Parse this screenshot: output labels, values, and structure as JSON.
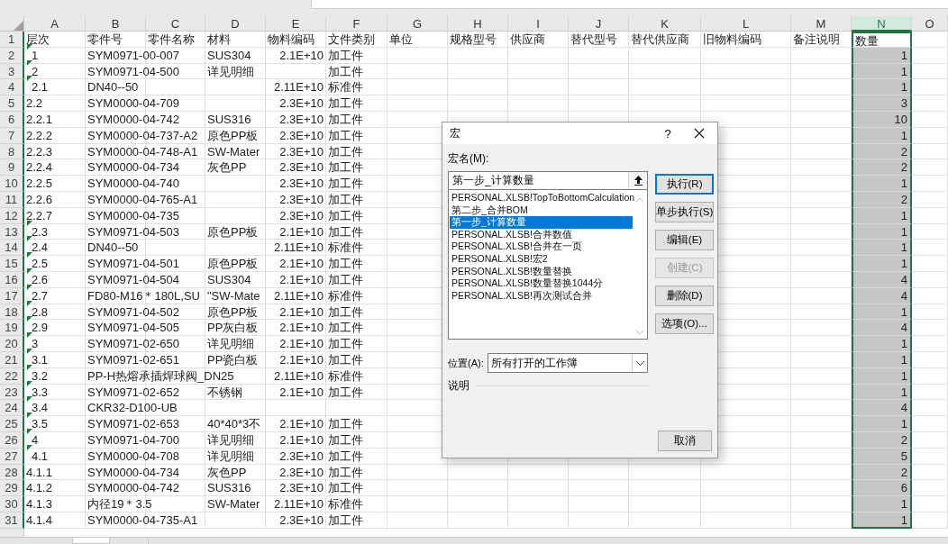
{
  "columns": [
    {
      "label": "A",
      "kind": "text",
      "selected": false
    },
    {
      "label": "B",
      "kind": "text",
      "selected": false
    },
    {
      "label": "C",
      "kind": "text",
      "selected": false
    },
    {
      "label": "D",
      "kind": "text",
      "selected": false
    },
    {
      "label": "E",
      "kind": "number",
      "selected": false
    },
    {
      "label": "F",
      "kind": "text",
      "selected": false
    },
    {
      "label": "G",
      "kind": "text",
      "selected": false
    },
    {
      "label": "H",
      "kind": "text",
      "selected": false
    },
    {
      "label": "I",
      "kind": "text",
      "selected": false
    },
    {
      "label": "J",
      "kind": "text",
      "selected": false
    },
    {
      "label": "K",
      "kind": "text",
      "selected": false
    },
    {
      "label": "L",
      "kind": "text",
      "selected": false
    },
    {
      "label": "M",
      "kind": "text",
      "selected": false
    },
    {
      "label": "N",
      "kind": "number",
      "selected": true
    },
    {
      "label": "O",
      "kind": "text",
      "selected": false
    }
  ],
  "rows": [
    {
      "number": "1",
      "kind": "header",
      "error_flag": false,
      "cells": {
        "A": "层次",
        "B": "零件号",
        "C": "零件名称",
        "D": "材料",
        "E": "物料编码",
        "F": "文件类别",
        "G": "单位",
        "H": "规格型号",
        "I": "供应商",
        "J": "替代型号",
        "K": "替代供应商",
        "L": "旧物料编码",
        "M": "备注说明",
        "N": "数量"
      }
    },
    {
      "number": "2",
      "kind": "data",
      "error_flag": true,
      "cells": {
        "A": "1",
        "B": "SYM0971-00-007",
        "D": "SUS304",
        "E": "2.1E+10",
        "F": "加工件",
        "N": "1"
      }
    },
    {
      "number": "3",
      "kind": "data",
      "error_flag": true,
      "cells": {
        "A": "2",
        "B": "SYM0971-04-500",
        "D": "详见明细",
        "F": "加工件",
        "N": "1"
      }
    },
    {
      "number": "4",
      "kind": "data",
      "error_flag": true,
      "cells": {
        "A": "2.1",
        "B": "DN40--50",
        "E": "2.11E+10",
        "F": "标准件",
        "N": "1"
      }
    },
    {
      "number": "5",
      "kind": "data",
      "error_flag": false,
      "cells": {
        "A": "2.2",
        "B": "SYM0000-04-709",
        "E": "2.3E+10",
        "F": "加工件",
        "N": "3"
      }
    },
    {
      "number": "6",
      "kind": "data",
      "error_flag": false,
      "cells": {
        "A": "2.2.1",
        "B": "SYM0000-04-742",
        "D": "SUS316",
        "E": "2.3E+10",
        "F": "加工件",
        "N": "10"
      }
    },
    {
      "number": "7",
      "kind": "data",
      "error_flag": false,
      "cells": {
        "A": "2.2.2",
        "B": "SYM0000-04-737-A2",
        "D": "原色PP板",
        "E": "2.3E+10",
        "F": "加工件",
        "N": "1"
      }
    },
    {
      "number": "8",
      "kind": "data",
      "error_flag": false,
      "cells": {
        "A": "2.2.3",
        "B": "SYM0000-04-748-A1",
        "D": "SW-Mater",
        "E": "2.3E+10",
        "F": "加工件",
        "N": "2"
      }
    },
    {
      "number": "9",
      "kind": "data",
      "error_flag": false,
      "cells": {
        "A": "2.2.4",
        "B": "SYM0000-04-734",
        "D": "灰色PP",
        "E": "2.3E+10",
        "F": "加工件",
        "N": "2"
      }
    },
    {
      "number": "10",
      "kind": "data",
      "error_flag": false,
      "cells": {
        "A": "2.2.5",
        "B": "SYM0000-04-740",
        "E": "2.3E+10",
        "F": "加工件",
        "N": "1"
      }
    },
    {
      "number": "11",
      "kind": "data",
      "error_flag": false,
      "cells": {
        "A": "2.2.6",
        "B": "SYM0000-04-765-A1",
        "E": "2.3E+10",
        "F": "加工件",
        "N": "2"
      }
    },
    {
      "number": "12",
      "kind": "data",
      "error_flag": false,
      "cells": {
        "A": "2.2.7",
        "B": "SYM0000-04-735",
        "E": "2.3E+10",
        "F": "加工件",
        "N": "1"
      }
    },
    {
      "number": "13",
      "kind": "data",
      "error_flag": true,
      "cells": {
        "A": "2.3",
        "B": "SYM0971-04-503",
        "D": "原色PP板",
        "E": "2.1E+10",
        "F": "加工件",
        "N": "1"
      }
    },
    {
      "number": "14",
      "kind": "data",
      "error_flag": true,
      "cells": {
        "A": "2.4",
        "B": "DN40--50",
        "E": "2.11E+10",
        "F": "标准件",
        "N": "1"
      }
    },
    {
      "number": "15",
      "kind": "data",
      "error_flag": true,
      "cells": {
        "A": "2.5",
        "B": "SYM0971-04-501",
        "D": "原色PP板",
        "E": "2.1E+10",
        "F": "加工件",
        "N": "1"
      }
    },
    {
      "number": "16",
      "kind": "data",
      "error_flag": true,
      "cells": {
        "A": "2.6",
        "B": "SYM0971-04-504",
        "D": "SUS304",
        "E": "2.1E+10",
        "F": "加工件",
        "N": "4"
      }
    },
    {
      "number": "17",
      "kind": "data",
      "error_flag": true,
      "cells": {
        "A": "2.7",
        "B": "FD80-M16＊180L,SU",
        "D": "\"SW-Mate",
        "E": "2.11E+10",
        "F": "标准件",
        "N": "4"
      }
    },
    {
      "number": "18",
      "kind": "data",
      "error_flag": true,
      "cells": {
        "A": "2.8",
        "B": "SYM0971-04-502",
        "D": "原色PP板",
        "E": "2.1E+10",
        "F": "加工件",
        "N": "1"
      }
    },
    {
      "number": "19",
      "kind": "data",
      "error_flag": true,
      "cells": {
        "A": "2.9",
        "B": "SYM0971-04-505",
        "D": "PP灰白板",
        "E": "2.1E+10",
        "F": "加工件",
        "N": "4"
      }
    },
    {
      "number": "20",
      "kind": "data",
      "error_flag": true,
      "cells": {
        "A": "3",
        "B": "SYM0971-02-650",
        "D": "详见明细",
        "E": "2.1E+10",
        "F": "加工件",
        "N": "1"
      }
    },
    {
      "number": "21",
      "kind": "data",
      "error_flag": true,
      "cells": {
        "A": "3.1",
        "B": "SYM0971-02-651",
        "D": "PP瓷白板",
        "E": "2.1E+10",
        "F": "加工件",
        "N": "1"
      }
    },
    {
      "number": "22",
      "kind": "data",
      "error_flag": true,
      "cells": {
        "A": "3.2",
        "B": "PP-H热熔承插焊球阀_DN25",
        "E": "2.11E+10",
        "F": "标准件",
        "N": "1"
      }
    },
    {
      "number": "23",
      "kind": "data",
      "error_flag": true,
      "cells": {
        "A": "3.3",
        "B": "SYM0971-02-652",
        "D": "不锈钢",
        "E": "2.1E+10",
        "F": "加工件",
        "N": "1"
      }
    },
    {
      "number": "24",
      "kind": "data",
      "error_flag": true,
      "cells": {
        "A": "3.4",
        "B": "CKR32-D100-UB",
        "N": "4"
      }
    },
    {
      "number": "25",
      "kind": "data",
      "error_flag": true,
      "cells": {
        "A": "3.5",
        "B": "SYM0971-02-653",
        "D": "40*40*3不",
        "E": "2.1E+10",
        "F": "加工件",
        "N": "1"
      }
    },
    {
      "number": "26",
      "kind": "data",
      "error_flag": true,
      "cells": {
        "A": "4",
        "B": "SYM0971-04-700",
        "D": "详见明细",
        "E": "2.1E+10",
        "F": "加工件",
        "N": "2"
      }
    },
    {
      "number": "27",
      "kind": "data",
      "error_flag": true,
      "cells": {
        "A": "4.1",
        "B": "SYM0000-04-708",
        "D": "详见明细",
        "E": "2.3E+10",
        "F": "加工件",
        "N": "5"
      }
    },
    {
      "number": "28",
      "kind": "data",
      "error_flag": false,
      "cells": {
        "A": "4.1.1",
        "B": "SYM0000-04-734",
        "D": "灰色PP",
        "E": "2.3E+10",
        "F": "加工件",
        "N": "2"
      }
    },
    {
      "number": "29",
      "kind": "data",
      "error_flag": false,
      "cells": {
        "A": "4.1.2",
        "B": "SYM0000-04-742",
        "D": "SUS316",
        "E": "2.3E+10",
        "F": "加工件",
        "N": "6"
      }
    },
    {
      "number": "30",
      "kind": "data",
      "error_flag": false,
      "cells": {
        "A": "4.1.3",
        "B": "内径19＊3.5",
        "D": "SW-Mater",
        "E": "2.11E+10",
        "F": "标准件",
        "N": "1"
      }
    },
    {
      "number": "31",
      "kind": "data",
      "error_flag": false,
      "cells": {
        "A": "4.1.4",
        "B": "SYM0000-04-735-A1",
        "E": "2.3E+10",
        "F": "加工件",
        "N": "1"
      }
    }
  ],
  "macro_dialog": {
    "title": "宏",
    "help": "?",
    "name_label": "宏名(M):",
    "name_value": "第一步_计算数量",
    "macros": [
      {
        "label": "PERSONAL.XLSB!TopToBottomCalculation",
        "selected": false
      },
      {
        "label": "第二步_合并BOM",
        "selected": false
      },
      {
        "label": "第一步_计算数量",
        "selected": true
      },
      {
        "label": "PERSONAL.XLSB!合并数值",
        "selected": false
      },
      {
        "label": "PERSONAL.XLSB!合并在一页",
        "selected": false
      },
      {
        "label": "PERSONAL.XLSB!宏2",
        "selected": false
      },
      {
        "label": "PERSONAL.XLSB!数量替换",
        "selected": false
      },
      {
        "label": "PERSONAL.XLSB!数量替换1044分",
        "selected": false
      },
      {
        "label": "PERSONAL.XLSB!再次测试合并",
        "selected": false
      }
    ],
    "buttons": [
      {
        "label": "执行(R)",
        "default": true,
        "disabled": false
      },
      {
        "label": "单步执行(S)",
        "default": false,
        "disabled": false
      },
      {
        "label": "编辑(E)",
        "default": false,
        "disabled": false
      },
      {
        "label": "创建(C)",
        "default": false,
        "disabled": true
      },
      {
        "label": "删除(D)",
        "default": false,
        "disabled": false
      },
      {
        "label": "选项(O)...",
        "default": false,
        "disabled": false
      }
    ],
    "location_label": "位置(A):",
    "location_value": "所有打开的工作簿",
    "description_label": "说明",
    "cancel_label": "取消"
  }
}
